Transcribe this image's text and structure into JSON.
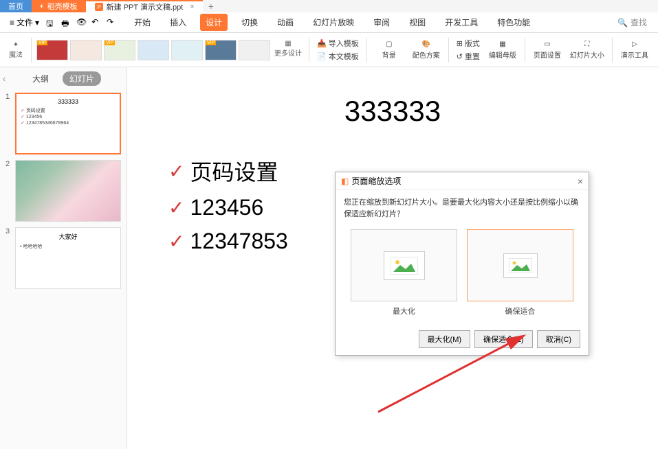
{
  "tabs": {
    "home": "首页",
    "template": "稻壳模板",
    "doc": "新建 PPT 演示文稿.ppt"
  },
  "menubar": {
    "file_menu": "文件",
    "search_placeholder": "查找"
  },
  "ribbon_tabs": [
    "开始",
    "插入",
    "设计",
    "切换",
    "动画",
    "幻灯片放映",
    "审阅",
    "视图",
    "开发工具",
    "特色功能"
  ],
  "ribbon_active": "设计",
  "ribbon": {
    "magic": "魔法",
    "more_design": "更多设计",
    "import_template": "导入模板",
    "local_template": "本文模板",
    "background": "背景",
    "color_scheme": "配色方案",
    "layout": "版式",
    "reset": "重置",
    "edit_master": "编辑母版",
    "page_setup": "页面设置",
    "slide_size": "幻灯片大小",
    "presenter_tools": "演示工具"
  },
  "panel": {
    "outline_tab": "大纲",
    "slides_tab": "幻灯片"
  },
  "slides": [
    {
      "num": "1",
      "title": "333333",
      "bullets": [
        "页码设置",
        "123456",
        "1234785346678964"
      ]
    },
    {
      "num": "2",
      "image": true
    },
    {
      "num": "3",
      "title": "大家好",
      "bullets": [
        "哈哈哈哈"
      ]
    }
  ],
  "canvas": {
    "title": "333333",
    "bullets": [
      "页码设置",
      "123456",
      "12347853"
    ]
  },
  "dialog": {
    "title": "页面缩放选项",
    "message": "您正在缩放到新幻灯片大小。是要最大化内容大小还是按比例缩小以确保适应新幻灯片？",
    "option_maximize": "最大化",
    "option_fit": "确保适合",
    "btn_maximize": "最大化(M)",
    "btn_fit": "确保适合(E)",
    "btn_cancel": "取消(C)"
  }
}
